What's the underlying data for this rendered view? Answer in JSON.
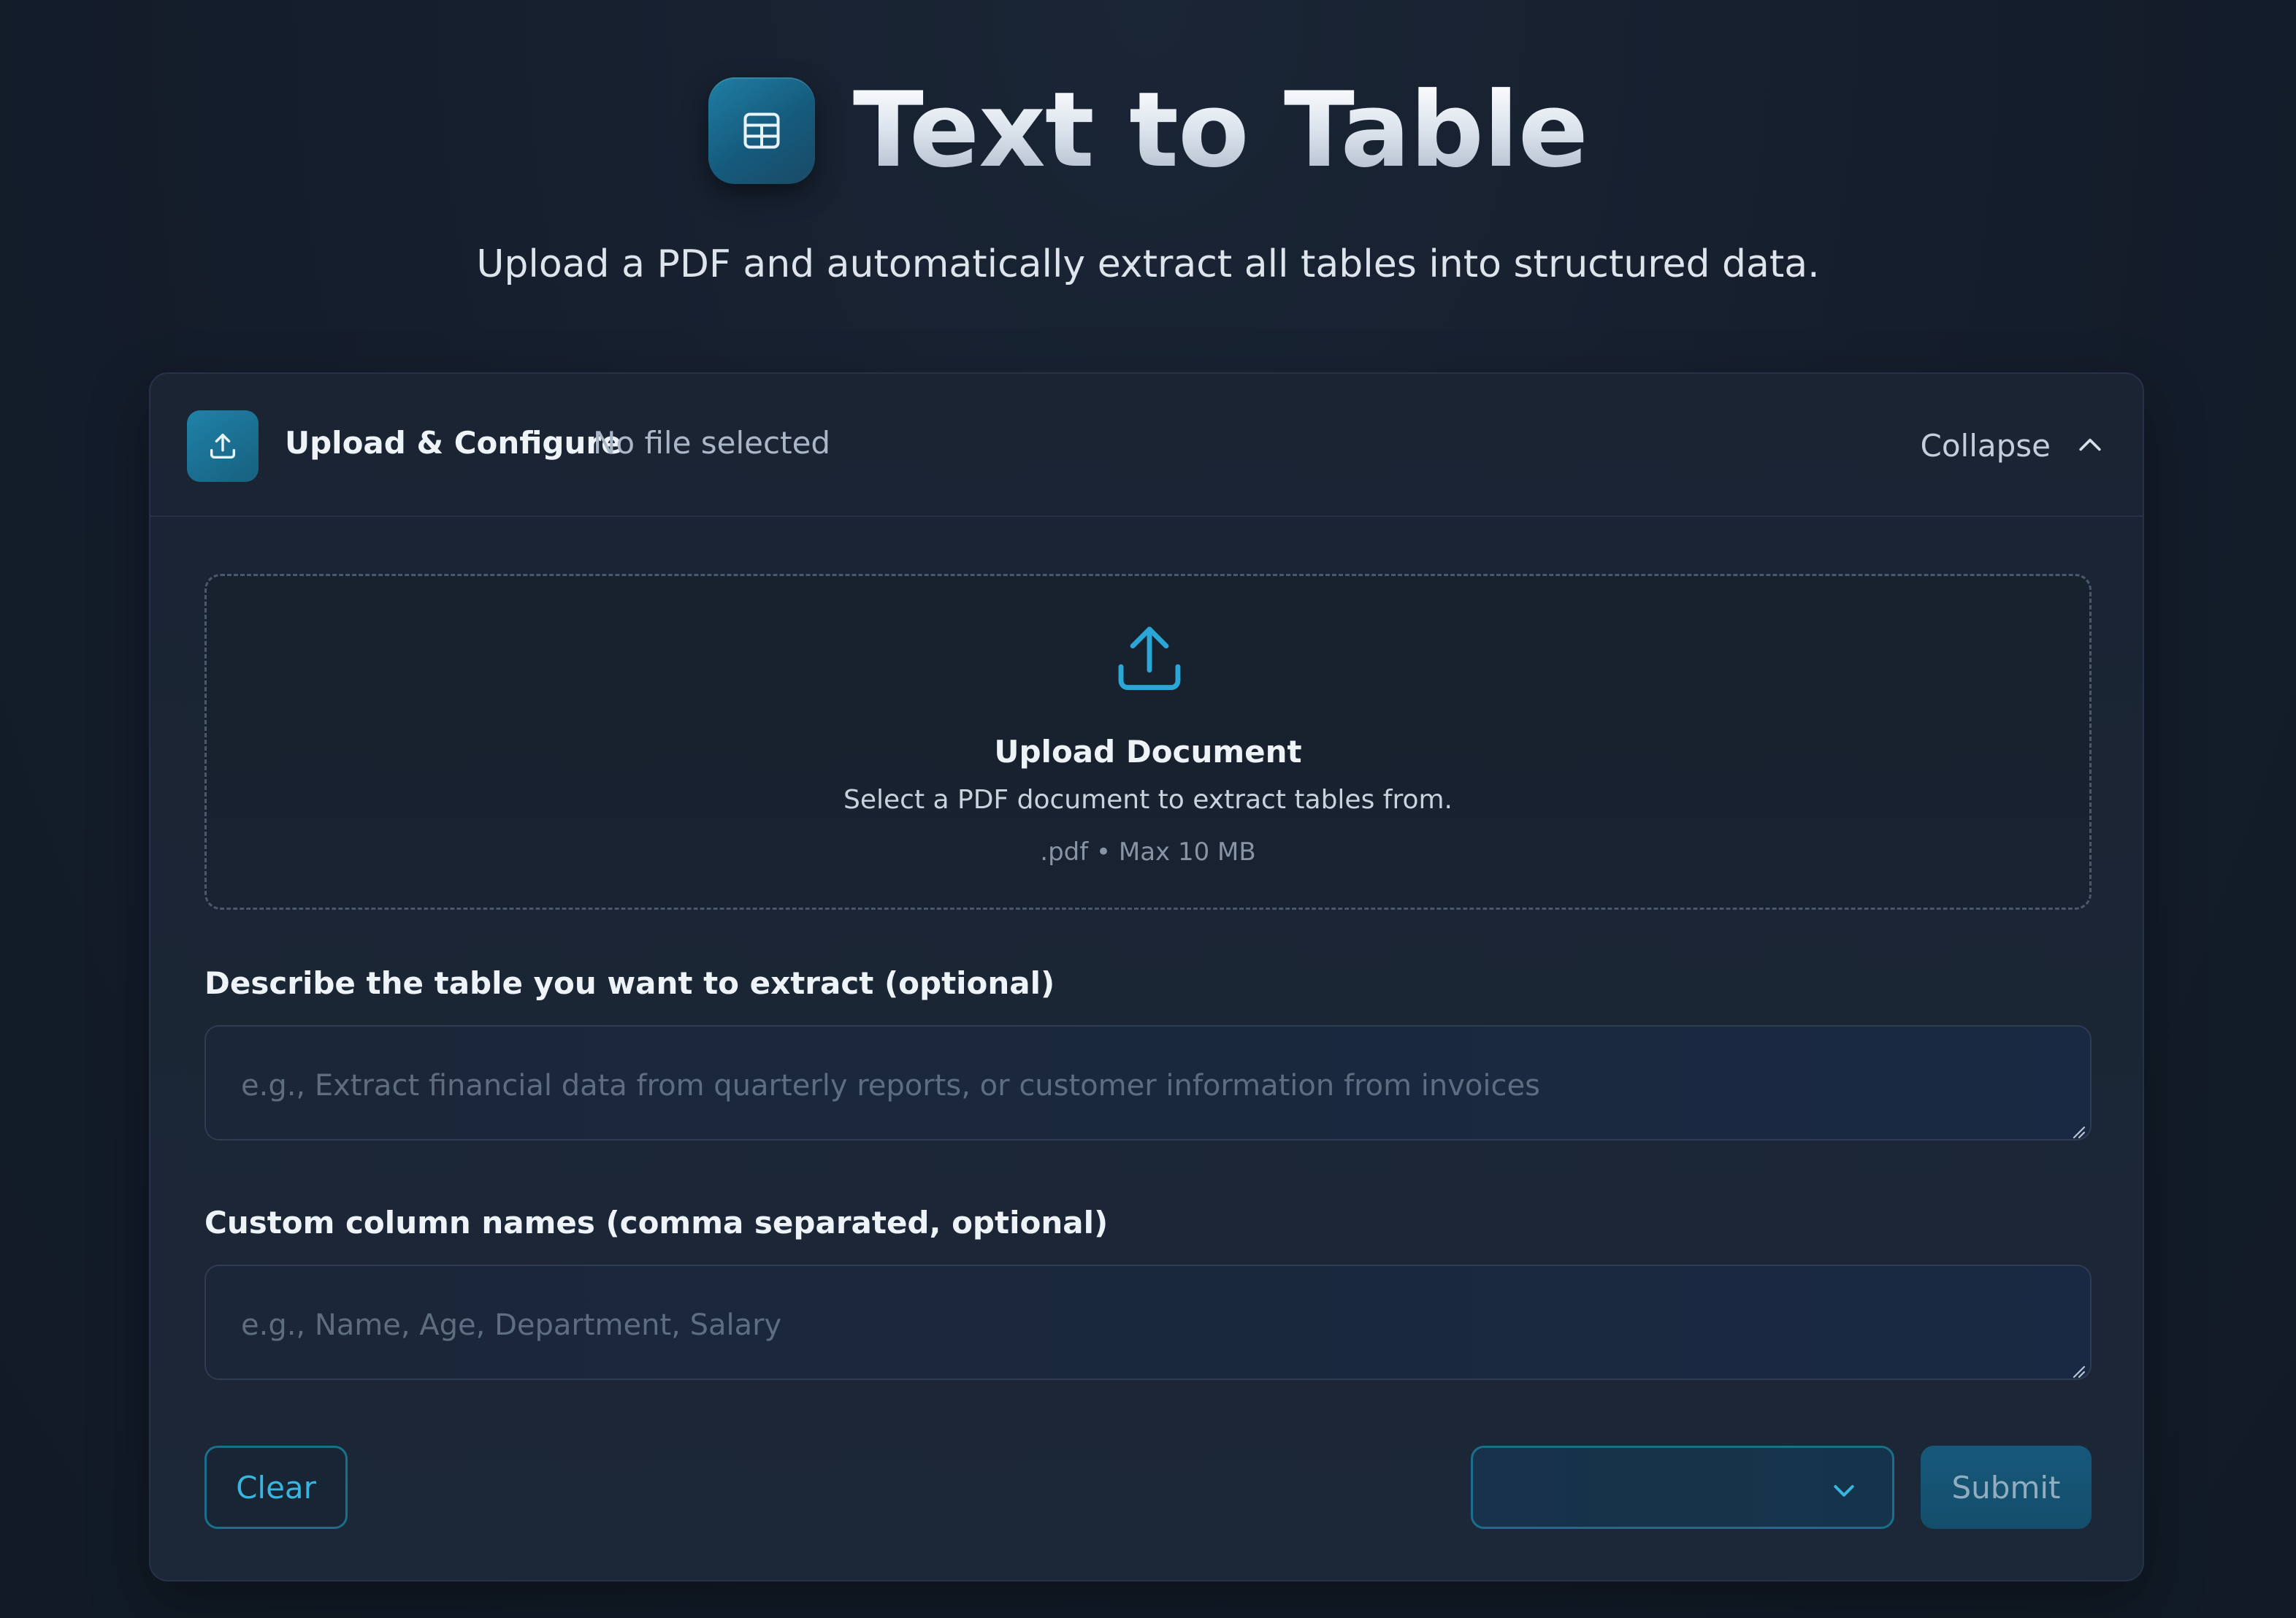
{
  "app": {
    "title": "Text to Table",
    "subtitle": "Upload a PDF and automatically extract all tables into structured data."
  },
  "panel": {
    "title": "Upload & Configure",
    "status": "No file selected",
    "collapse_label": "Collapse"
  },
  "dropzone": {
    "title": "Upload Document",
    "description": "Select a PDF document to extract tables from.",
    "hint": ".pdf • Max 10 MB"
  },
  "form": {
    "description_label": "Describe the table you want to extract (optional)",
    "description_placeholder": "e.g., Extract financial data from quarterly reports, or customer information from invoices",
    "description_value": "",
    "columns_label": "Custom column names (comma separated, optional)",
    "columns_placeholder": "e.g., Name, Age, Department, Salary",
    "columns_value": ""
  },
  "actions": {
    "clear_label": "Clear",
    "select_value": "",
    "submit_label": "Submit"
  },
  "icons": {
    "logo": "table-grid-icon",
    "panel": "upload-icon",
    "dropzone": "upload-icon",
    "collapse": "chevron-up-icon",
    "select": "chevron-down-icon"
  },
  "colors": {
    "accent": "#38b6e0",
    "accent_border": "#1a6f8a",
    "background": "#141d2b",
    "card": "#1a2433"
  }
}
